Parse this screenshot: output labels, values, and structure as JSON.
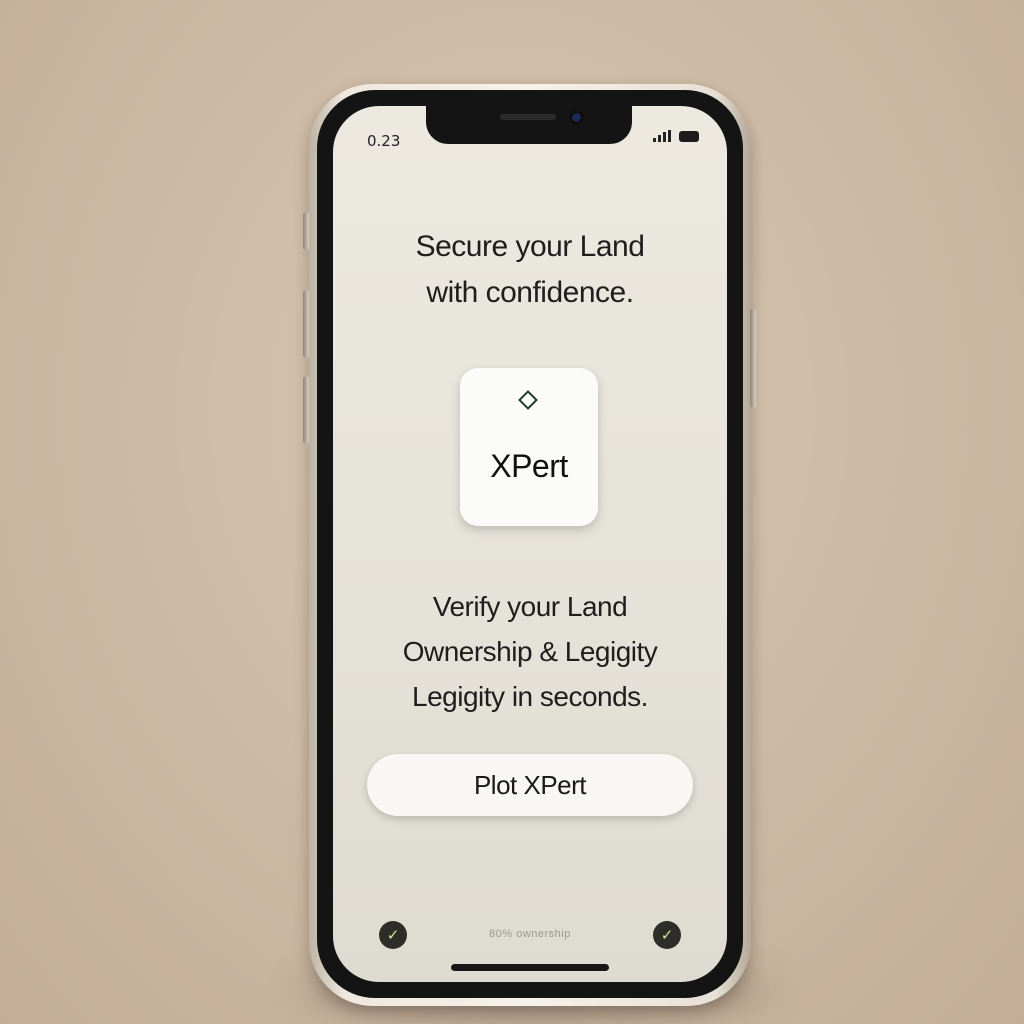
{
  "status_bar": {
    "time": "0.23",
    "icons": [
      "signal-icon",
      "battery-icon"
    ]
  },
  "headline": {
    "line1": "Secure your Land",
    "line2": "with confidence."
  },
  "app_tile": {
    "icon": "diamond-icon",
    "label": "XPert"
  },
  "subtext": {
    "line1": "Verify your Land",
    "line2": "Ownership & Legigity",
    "line3": "Legigity in seconds."
  },
  "cta": {
    "label": "Plot XPert"
  },
  "footer": {
    "left_icon": "check-icon",
    "right_icon": "check-icon",
    "check_glyph": "✓",
    "text": "80% ownership"
  },
  "colors": {
    "background": "#cdb9a3",
    "screen": "#e6e3da",
    "text": "#1e1e1e",
    "icon_dark": "#2e2e28"
  }
}
